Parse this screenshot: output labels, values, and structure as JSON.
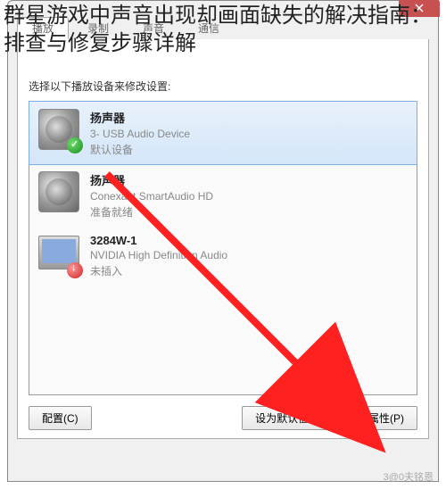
{
  "article": {
    "title": "群星游戏中声音出现却画面缺失的解决指南：排查与修复步骤详解"
  },
  "tabs": {
    "playback": "播放",
    "record": "录制",
    "sounds": "声音",
    "comm": "通信"
  },
  "instruction": "选择以下播放设备来修改设置:",
  "devices": [
    {
      "name": "扬声器",
      "desc": "3- USB Audio Device",
      "status": "默认设备"
    },
    {
      "name": "扬声器",
      "desc": "Conexant SmartAudio HD",
      "status": "准备就绪"
    },
    {
      "name": "3284W-1",
      "desc": "NVIDIA High Definition Audio",
      "status": "未插入"
    }
  ],
  "buttons": {
    "configure": "配置(C)",
    "setdefault": "设为默认值(S)",
    "properties": "属性(P)"
  },
  "watermark": "3@0夫铭恩"
}
